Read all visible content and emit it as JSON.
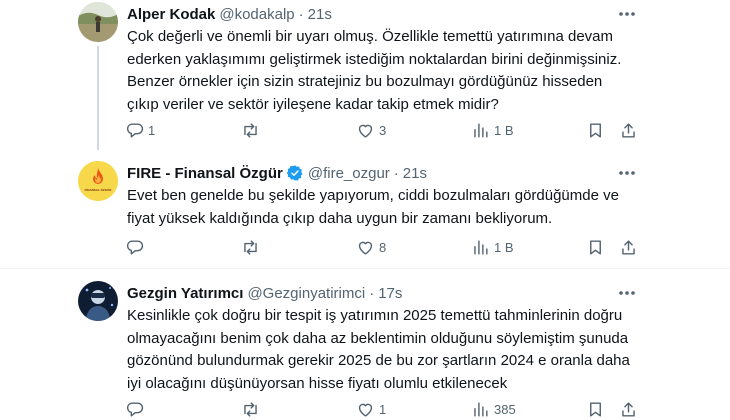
{
  "tweets": [
    {
      "name": "Alper Kodak",
      "handle": "@kodakalp",
      "sep": "·",
      "time": "21s",
      "lines": [
        "Çok değerli ve önemli bir uyarı olmuş. Özellikle temettü yatırımına devam",
        "ederken yaklaşımımı geliştirmek istediğim noktalardan birini değinmişsiniz.",
        "Benzer örnekler için sizin stratejiniz bu bozulmayı gördüğünüz hisseden",
        "çıkıp veriler ve sektör iyileşene kadar takip etmek midir?"
      ],
      "replies": "1",
      "retweets": "",
      "likes": "3",
      "views": "1 B"
    },
    {
      "name": "FIRE - Finansal Özgür",
      "handle": "@fire_ozgur",
      "sep": "·",
      "time": "21s",
      "verified": true,
      "avatar_text": "FİNANSAL ÖZGÜR",
      "lines": [
        "Evet ben genelde bu şekilde yapıyorum, ciddi bozulmaları gördüğümde ve",
        "fiyat yüksek kaldığında çıkıp daha uygun bir zamanı bekliyorum."
      ],
      "replies": "",
      "retweets": "",
      "likes": "8",
      "views": "1 B"
    },
    {
      "name": "Gezgin Yatırımcı",
      "handle": "@Gezginyatirimci",
      "sep": "·",
      "time": "17s",
      "lines": [
        "Kesinlikle çok doğru bir tespit iş yatırımın 2025 temettü tahminlerinin doğru",
        "olmayacağını benim çok daha az beklentimin olduğunu söylemiştim şunuda",
        "gözönünd bulundurmak gerekir 2025 de bu zor şartların 2024 e oranla daha",
        "iyi olacağını düşünüyorsan hisse fiyatı olumlu etkilenecek"
      ],
      "replies": "",
      "retweets": "",
      "likes": "1",
      "views": "385"
    }
  ],
  "colors": {
    "text": "#0f1419",
    "secondary": "#536471",
    "verified": "#1d9bf0",
    "divider": "#eff3f4",
    "thread_line": "#cfd9de"
  },
  "icons": [
    "reply-icon",
    "retweet-icon",
    "like-icon",
    "views-icon",
    "bookmark-icon",
    "share-icon",
    "more-icon",
    "verified-badge-icon"
  ]
}
